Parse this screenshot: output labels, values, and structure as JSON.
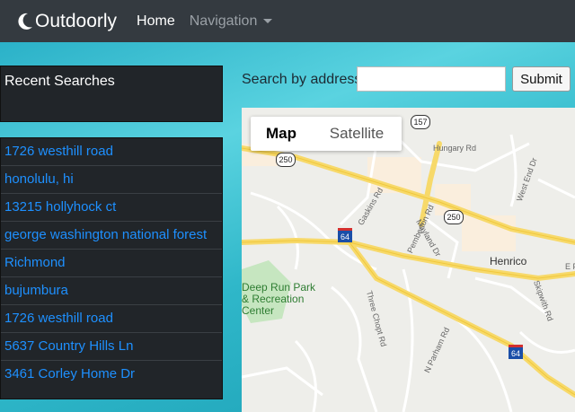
{
  "navbar": {
    "brand": "Outdoorly",
    "home": "Home",
    "navigation": "Navigation"
  },
  "sidebar": {
    "title": "Recent Searches",
    "items": [
      "1726 westhill road",
      "honolulu, hi",
      "13215 hollyhock ct",
      "george washington national forest",
      "Richmond",
      "bujumbura",
      "1726 westhill road",
      "5637 Country Hills Ln",
      "3461 Corley Home Dr"
    ]
  },
  "search": {
    "label": "Search by address",
    "value": "",
    "placeholder": "",
    "submit": "Submit"
  },
  "map": {
    "toggle": {
      "map": "Map",
      "satellite": "Satellite"
    },
    "places": {
      "henrico": "Henrico",
      "park": "Deep Run Park & Recreation Center"
    },
    "roads": {
      "hungary": "Hungary Rd",
      "west_end": "West End Dr",
      "gaskins": "Gaskins Rd",
      "pemberton": "Pemberton Rd",
      "mayland": "Mayland Dr",
      "skipwith": "Skipwith Rd",
      "three_chopt": "Three Chopt Rd",
      "n_parham": "N Parham Rd",
      "e_p": "E P"
    },
    "shields": {
      "r157": "157",
      "r250a": "250",
      "r250b": "250",
      "i64a": "64",
      "i64b": "64"
    }
  },
  "colors": {
    "navbar": "#343a40",
    "sidebar": "#212529",
    "link": "#1e90ff",
    "highway": "#f7d96a"
  },
  "icons": {
    "brand": "crescent-moon-icon"
  }
}
